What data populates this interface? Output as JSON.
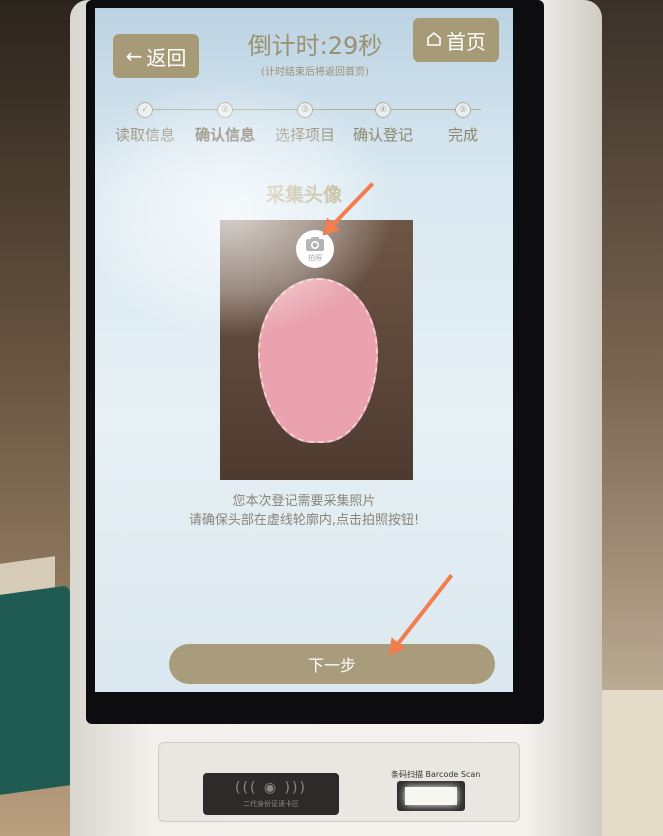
{
  "header": {
    "back_label": "返回",
    "countdown_title": "倒计时:29秒",
    "countdown_note": "(计时结束后将返回首页)",
    "home_label": "首页"
  },
  "steps": [
    {
      "label": "读取信息",
      "marker": "✓",
      "active": false
    },
    {
      "label": "确认信息",
      "marker": "②",
      "active": true
    },
    {
      "label": "选择项目",
      "marker": "③",
      "active": false
    },
    {
      "label": "确认登记",
      "marker": "④",
      "active": false
    },
    {
      "label": "完成",
      "marker": "⑤",
      "active": false
    }
  ],
  "capture": {
    "title": "采集头像",
    "camera_caption": "拍照"
  },
  "instructions": {
    "line1": "您本次登记需要采集照片",
    "line2": "请确保头部在虚线轮廓内,点击拍照按钮!"
  },
  "next_button_label": "下一步",
  "hardware": {
    "reader_caption": "二代身份证读卡区",
    "scan_label": "条码扫描 Barcode Scan"
  },
  "colors": {
    "accent": "#a69a77",
    "annotation_arrow": "#f47d4f"
  },
  "icons": {
    "back": "arrow-left-icon",
    "home": "home-icon",
    "camera": "camera-icon"
  }
}
